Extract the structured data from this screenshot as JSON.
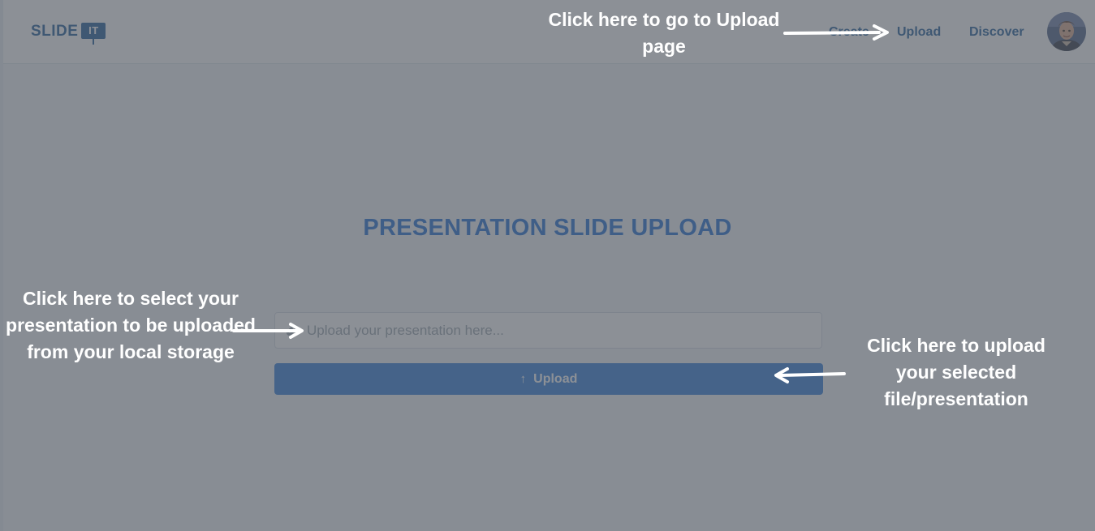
{
  "colors": {
    "brand_blue": "#1f5d99",
    "nav_link": "#1f5d99",
    "title_blue": "#1f6ed4",
    "button_bg": "#2f7dd9",
    "button_text": "#ffffff",
    "placeholder": "#9aa4ad",
    "annotation_text": "#ffffff"
  },
  "header": {
    "logo": {
      "text": "SLIDE",
      "badge": "IT"
    },
    "nav": [
      {
        "label": "Create"
      },
      {
        "label": "Upload"
      },
      {
        "label": "Discover"
      }
    ],
    "avatar_icon": "user-avatar-photo"
  },
  "main": {
    "title": "PRESENTATION SLIDE UPLOAD",
    "file_input": {
      "icon": "paperclip-icon",
      "placeholder": "Upload your presentation here..."
    },
    "upload_button": {
      "icon": "arrow-up-icon",
      "label": "Upload"
    }
  },
  "annotations": {
    "nav_upload": "Click here to go to Upload page",
    "select_file": "Click here to select your presentation to be uploaded from your local storage",
    "upload_button": "Click here to upload your selected file/presentation"
  }
}
